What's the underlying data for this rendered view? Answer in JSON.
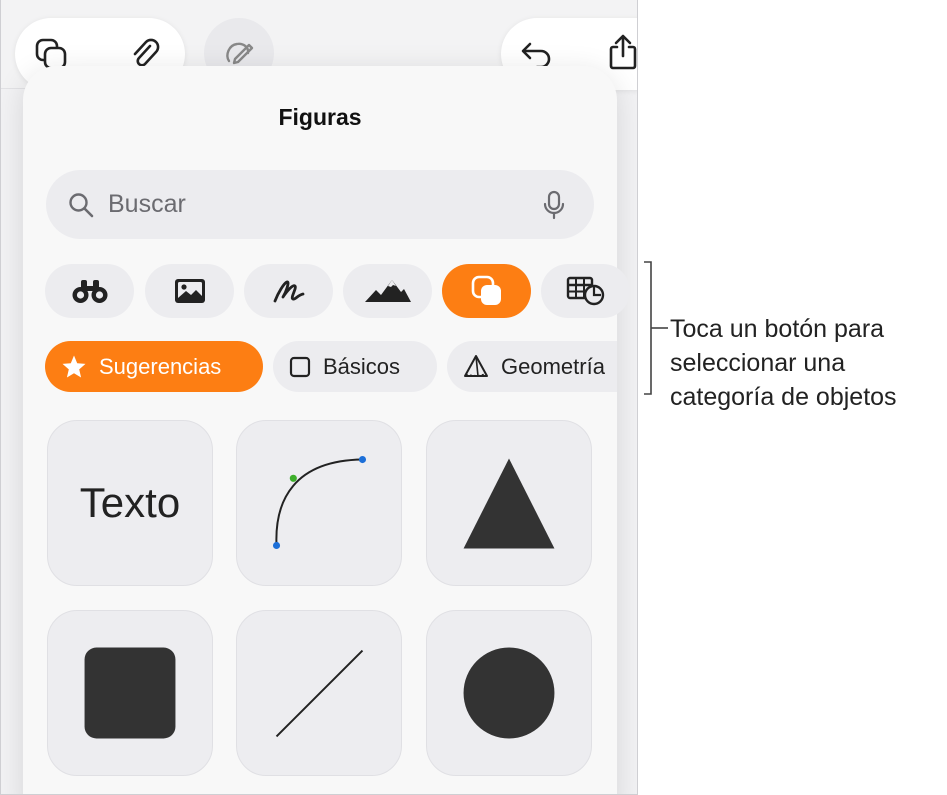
{
  "popover": {
    "title": "Figuras",
    "search_placeholder": "Buscar"
  },
  "categories": {
    "chips": [
      {
        "label": "Sugerencias",
        "icon": "star-icon",
        "active": true
      },
      {
        "label": "Básicos",
        "icon": "square-outline-icon",
        "active": false
      },
      {
        "label": "Geometría",
        "icon": "pyramid-icon",
        "active": false
      }
    ],
    "buttons": [
      {
        "icon": "binoculars-icon",
        "active": false
      },
      {
        "icon": "photo-icon",
        "active": false
      },
      {
        "icon": "scribble-icon",
        "active": false
      },
      {
        "icon": "mountains-icon",
        "active": false
      },
      {
        "icon": "shapes-icon",
        "active": true
      },
      {
        "icon": "table-chart-icon",
        "active": false
      }
    ]
  },
  "shapes": {
    "text_tile_label": "Texto"
  },
  "annotation": {
    "line1": "Toca un botón para",
    "line2": "seleccionar una",
    "line3": "categoría de objetos"
  },
  "colors": {
    "accent": "#fd7e13",
    "shape_fill": "#333333",
    "control_point_blue": "#1d6fd8",
    "control_point_green": "#3dae2b"
  }
}
